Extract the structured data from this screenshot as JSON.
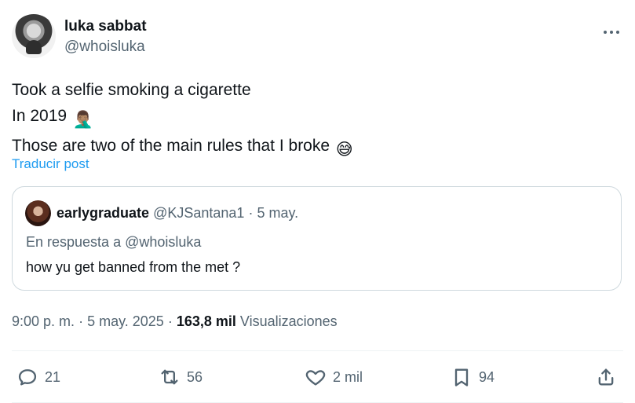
{
  "post": {
    "author": {
      "display_name": "luka sabbat",
      "handle": "@whoisluka"
    },
    "menu_icon": "more-horizontal-icon",
    "text_lines": [
      "Took a selfie smoking a cigarette",
      "In 2019",
      "Those are two of the main rules that I broke"
    ],
    "emoji": {
      "facepalm": "🤦🏽‍♂️",
      "sweat_smile": "😅"
    },
    "translate_label": "Traducir post",
    "quote": {
      "display_name": "earlygraduate",
      "handle": "@KJSantana1",
      "separator": "·",
      "date": "5 may.",
      "reply_to_prefix": "En respuesta a",
      "reply_to_handle": "@whoisluka",
      "text": "how yu get banned from the met ?"
    },
    "meta": {
      "time": "9:00 p. m.",
      "separator": "·",
      "date": "5 may. 2025",
      "views_count": "163,8 mil",
      "views_label": "Visualizaciones"
    },
    "actions": {
      "reply_count": "21",
      "repost_count": "56",
      "like_count": "2 mil",
      "bookmark_count": "94"
    }
  },
  "colors": {
    "text_primary": "#0f1419",
    "text_secondary": "#536471",
    "link_blue": "#1d9bf0",
    "border": "#cfd9de",
    "divider": "#eff3f4"
  }
}
